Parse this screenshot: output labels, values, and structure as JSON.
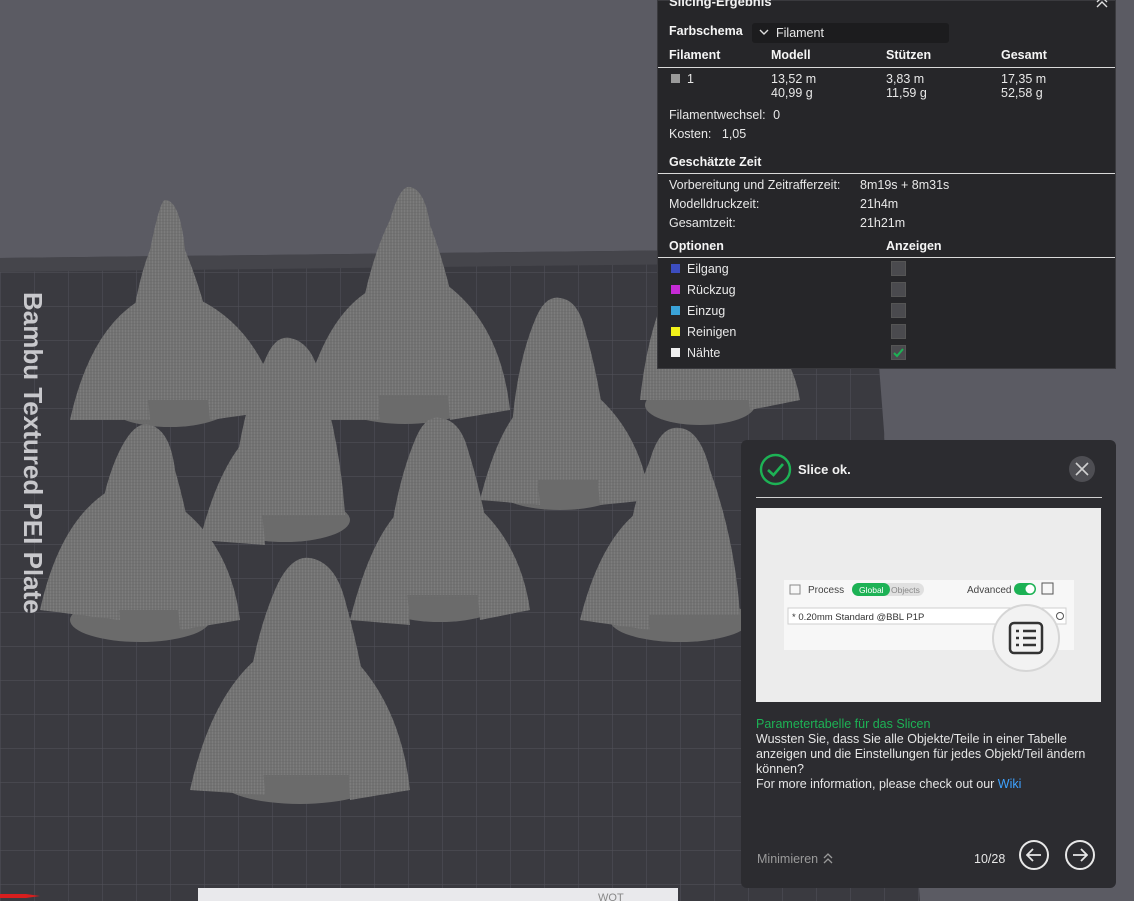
{
  "plate": {
    "label": "Bambu Textured PEI Plate"
  },
  "result": {
    "title": "Slicing-Ergebnis",
    "color_scheme_label": "Farbschema",
    "color_scheme_value": "Filament",
    "table_headers": [
      "Filament",
      "Modell",
      "Stützen",
      "Gesamt"
    ],
    "filament_row": {
      "id": "1",
      "color": "#9a9a9a",
      "model_length": "13,52 m",
      "model_weight": "40,99 g",
      "support_length": "3,83 m",
      "support_weight": "11,59 g",
      "total_length": "17,35 m",
      "total_weight": "52,58 g"
    },
    "filament_changes_label": "Filamentwechsel:",
    "filament_changes_value": "0",
    "cost_label": "Kosten:",
    "cost_value": "1,05",
    "time_header": "Geschätzte Zeit",
    "prep_label": "Vorbereitung und Zeitrafferzeit:",
    "prep_value": "8m19s + 8m31s",
    "model_time_label": "Modelldruckzeit:",
    "model_time_value": "21h4m",
    "total_time_label": "Gesamtzeit:",
    "total_time_value": "21h21m",
    "options_header": "Optionen",
    "show_header": "Anzeigen",
    "options": [
      {
        "label": "Eilgang",
        "color": "#3c4dbf",
        "checked": false
      },
      {
        "label": "Rückzug",
        "color": "#c62bd6",
        "checked": false
      },
      {
        "label": "Einzug",
        "color": "#3aa3d8",
        "checked": false
      },
      {
        "label": "Reinigen",
        "color": "#f2f21a",
        "checked": false
      },
      {
        "label": "Nähte",
        "color": "#f0f0f0",
        "checked": true
      }
    ]
  },
  "notification": {
    "title": "Slice ok.",
    "image": {
      "process_label": "Process",
      "global_label": "Global",
      "objects_label": "Objects",
      "advanced_label": "Advanced",
      "preset_text": "* 0.20mm Standard @BBL P1P"
    },
    "tip_title": "Parametertabelle für das Slicen",
    "tip_body": "Wussten Sie, dass Sie alle Objekte/Teile in einer Tabelle anzeigen und die Einstellungen für jedes Objekt/Teil ändern können?",
    "more_info_prefix": "For more information, please check out our",
    "wiki_link": "Wiki",
    "minimize_label": "Minimieren",
    "page_indicator": "10/28"
  },
  "toolbar_partial": {
    "text": "WOT"
  }
}
